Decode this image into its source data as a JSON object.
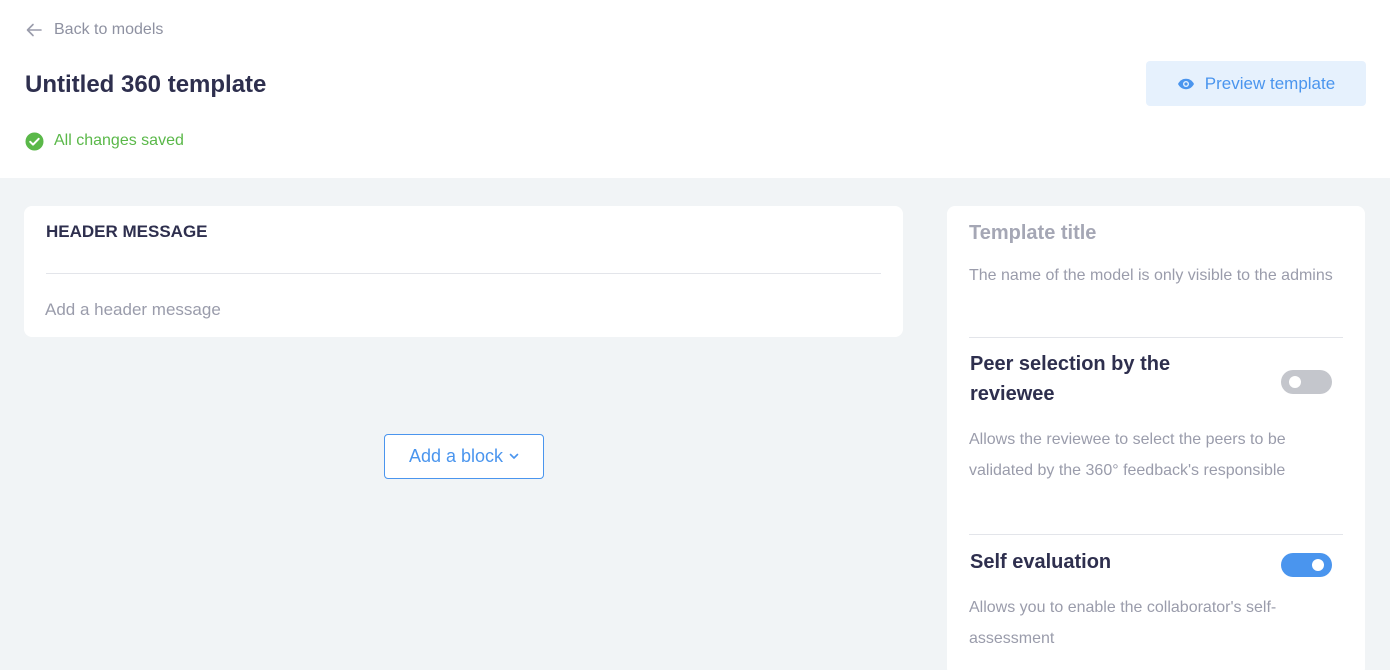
{
  "nav": {
    "back_label": "Back to models"
  },
  "header": {
    "title": "Untitled 360 template",
    "status": "All changes saved",
    "preview_label": "Preview template"
  },
  "header_message": {
    "title": "HEADER MESSAGE",
    "placeholder": "Add a header message"
  },
  "editor": {
    "add_block_label": "Add a block"
  },
  "settings": {
    "template_title_placeholder": "Template title",
    "template_title_desc": "The name of the model is only visible to the admins",
    "peer_selection": {
      "title": "Peer selection by the reviewee",
      "enabled": false,
      "desc": "Allows the reviewee to select the peers to be validated by the 360° feedback's responsible"
    },
    "self_evaluation": {
      "title": "Self evaluation",
      "enabled": true,
      "desc": "Allows you to enable the collaborator's self-assessment"
    }
  },
  "colors": {
    "accent": "#4a95ee",
    "success": "#5ab849",
    "title_text": "#2e2f4e",
    "muted_text": "#9a9cab",
    "background": "#f1f4f6"
  },
  "icons": {
    "back": "arrow-left-icon",
    "saved": "check-circle-icon",
    "preview": "eye-icon",
    "dropdown": "chevron-down-icon"
  }
}
